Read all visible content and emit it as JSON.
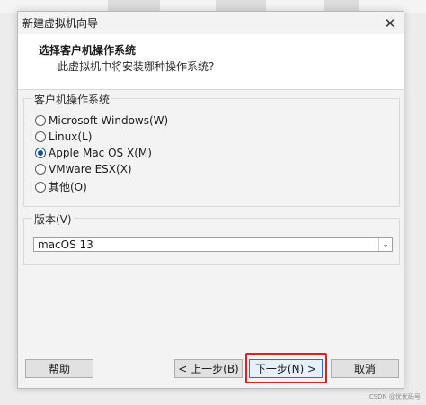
{
  "window": {
    "title": "新建虚拟机向导",
    "close_icon": "close-icon"
  },
  "header": {
    "heading": "选择客户机操作系统",
    "subheading": "此虚拟机中将安装哪种操作系统?"
  },
  "os_group": {
    "title": "客户机操作系统",
    "options": [
      {
        "label": "Microsoft Windows(W)",
        "checked": false
      },
      {
        "label": "Linux(L)",
        "checked": false
      },
      {
        "label": "Apple Mac OS X(M)",
        "checked": true
      },
      {
        "label": "VMware ESX(X)",
        "checked": false
      },
      {
        "label": "其他(O)",
        "checked": false
      }
    ]
  },
  "version_group": {
    "title": "版本(V)",
    "selected": "macOS 13",
    "dropdown_icon": "chevron-down-icon"
  },
  "footer": {
    "help": "帮助",
    "back": "< 上一步(B)",
    "next": "下一步(N) >",
    "cancel": "取消"
  },
  "watermark": "CSDN @优优码号",
  "colors": {
    "highlight": "#e0201c",
    "radio_checked": "#1f4e9c"
  }
}
